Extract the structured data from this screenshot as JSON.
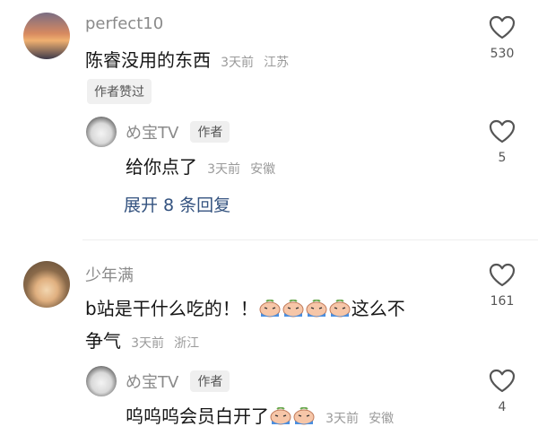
{
  "comments": [
    {
      "username": "perfect10",
      "text": "陈睿没用的东西",
      "time": "3天前",
      "location": "江苏",
      "liked_by_author": "作者赞过",
      "likes": "530",
      "reply": {
        "username": "め宝TV",
        "author_tag": "作者",
        "text": "给你点了",
        "time": "3天前",
        "location": "安徽",
        "likes": "5"
      },
      "expand_replies": "展开 8 条回复"
    },
    {
      "username": "少年满",
      "text_before": "b站是干什么吃的！！",
      "text_after": "这么不",
      "text_line2": "争气",
      "emoji_name": "crying-emoji",
      "time": "3天前",
      "location": "浙江",
      "likes": "161",
      "reply": {
        "username": "め宝TV",
        "author_tag": "作者",
        "text": "呜呜呜会员白开了",
        "emoji_name": "crying-emoji",
        "time": "3天前",
        "location": "安徽",
        "likes": "4"
      }
    }
  ],
  "colors": {
    "link": "#33527f",
    "username": "#8a8a8a",
    "meta": "#9a9a9a"
  }
}
